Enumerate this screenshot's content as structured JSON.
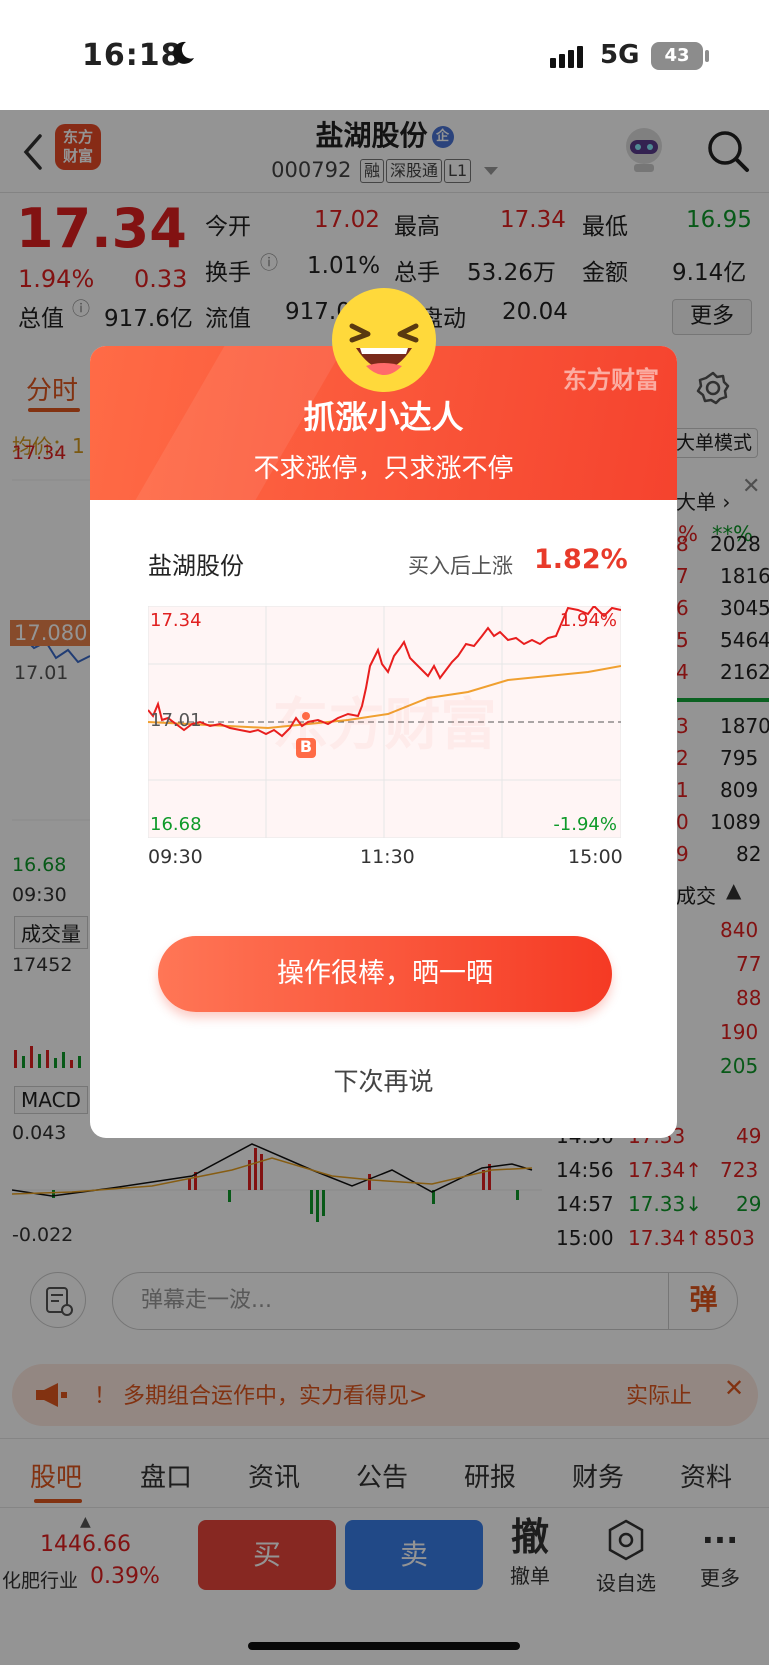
{
  "status": {
    "time": "16:18",
    "network": "5G",
    "battery": "43"
  },
  "header": {
    "back_icon": "chevron-left-icon",
    "logo_line1": "东方",
    "logo_line2": "财富",
    "stock_name": "盐湖股份",
    "qi_badge": "企",
    "code": "000792",
    "tags": [
      "融",
      "深股通",
      "L1"
    ]
  },
  "quote": {
    "price": "17.34",
    "pct": "1.94%",
    "change": "0.33",
    "row1": [
      {
        "label": "今开",
        "value": "17.02"
      },
      {
        "label": "最高",
        "value": "17.34"
      },
      {
        "label": "最低",
        "value": "16.95"
      }
    ],
    "row2": [
      {
        "label": "换手",
        "value": "1.01%"
      },
      {
        "label": "总手",
        "value": "53.26万"
      },
      {
        "label": "金额",
        "value": "9.14亿"
      }
    ],
    "row3": [
      {
        "label": "总值",
        "value": "917.6亿"
      },
      {
        "label": "流值",
        "value": "917.0"
      },
      {
        "label": "盘动",
        "value": "20.04"
      }
    ],
    "more": "更多"
  },
  "chart": {
    "tab": "分时",
    "avg_label": "均价：1",
    "bigorder_mode": "大单模式",
    "bigorder_link": "大单 ›",
    "high": "17.34",
    "marker_price": "17.080",
    "mid_price": "17.01",
    "low": "16.68",
    "start_time": "09:30",
    "vol_label": "成交量",
    "vol_max": "17452",
    "macd_label": "MACD",
    "macd_max": "0.043",
    "macd_min": "-0.022",
    "pct_header": "%",
    "pct_header2": "**%",
    "orderbook": [
      "2028",
      "1816",
      "3045",
      "5464",
      "2162",
      "1870",
      "795",
      "809",
      "1089",
      "82"
    ],
    "orderbook_prefix": [
      "8",
      "7",
      "6",
      "5",
      "4",
      "3",
      "2",
      "1",
      "0",
      "9"
    ],
    "deals_label": "成交",
    "deals_vol": [
      "840",
      "77",
      "88",
      "190",
      "205"
    ],
    "ticks": [
      {
        "time": "14:56",
        "price": "17.34↑",
        "vol": "723"
      },
      {
        "time": "14:57",
        "price": "17.33↓",
        "vol": "29"
      },
      {
        "time": "15:00",
        "price": "17.34↑",
        "vol": "8503"
      }
    ],
    "tick_partial": {
      "time": "14:56",
      "price": "17.33",
      "vol": "49"
    }
  },
  "danmu": {
    "placeholder": "弹幕走一波...",
    "button": "弹"
  },
  "banner": {
    "text": "！ 多期组合运作中，实力看得见>",
    "link": "实际止",
    "close": "✕"
  },
  "bottom_tabs": [
    "股吧",
    "盘口",
    "资讯",
    "公告",
    "研报",
    "财务",
    "资料"
  ],
  "trade": {
    "index_value": "1446.66",
    "index_name": "化肥行业",
    "index_pct": "0.39%",
    "buy": "买",
    "sell": "卖",
    "cancel_icon": "撤",
    "cancel": "撤单",
    "watch": "设自选",
    "more": "更多"
  },
  "modal": {
    "brand": "东方财富",
    "title": "抓涨小达人",
    "subtitle": "不求涨停，只求涨不停",
    "stock": "盐湖股份",
    "gain_label": "买入后上涨",
    "gain": "1.82%",
    "chart_high": "17.34",
    "chart_high_pct": "1.94%",
    "chart_mid": "17.01",
    "chart_low": "16.68",
    "chart_low_pct": "-1.94%",
    "buy_marker": "B",
    "times": [
      "09:30",
      "11:30",
      "15:00"
    ],
    "share_button": "操作很棒，晒一晒",
    "later": "下次再说",
    "watermark": "东方财富"
  },
  "colors": {
    "up": "#e02020",
    "down": "#0f9a2a",
    "accent": "#e0561e"
  }
}
